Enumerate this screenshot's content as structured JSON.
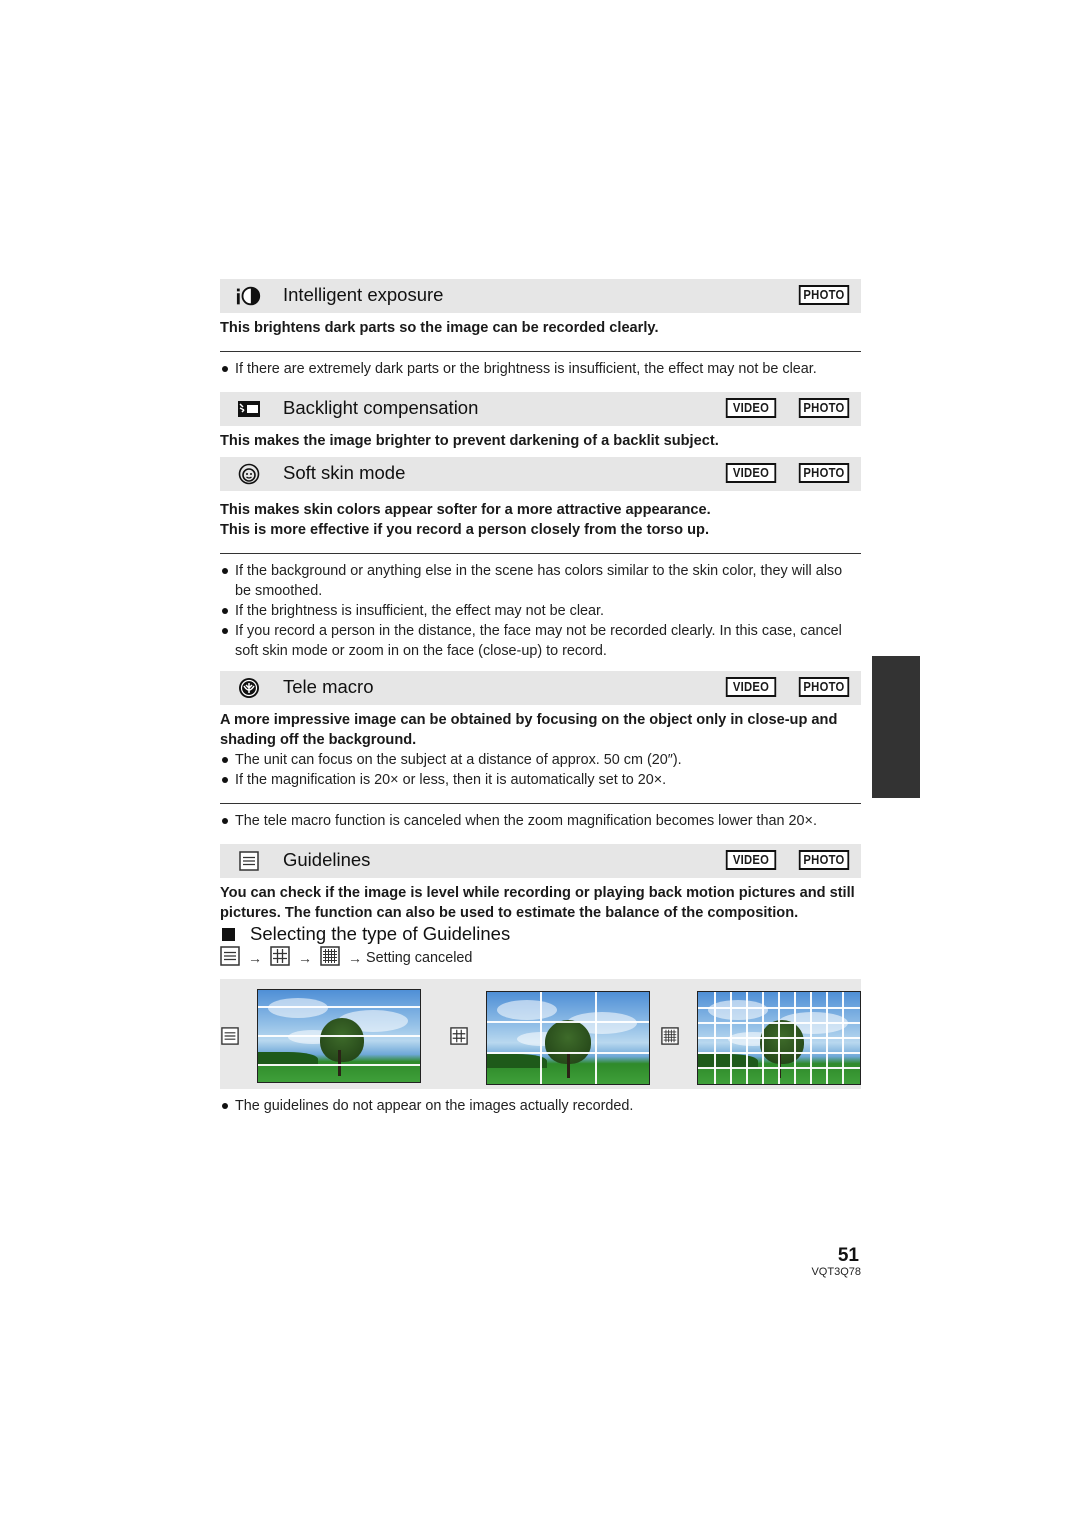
{
  "sections": [
    {
      "id": "intelligent-exposure",
      "icon": "intelligent-exposure-icon",
      "title": "Intelligent exposure",
      "badges": [
        "PHOTO"
      ],
      "lead": [
        "This brightens dark parts so the image can be recorded clearly."
      ],
      "notes": [
        "If there are extremely dark parts or the brightness is insufficient, the effect may not be clear."
      ]
    },
    {
      "id": "backlight-compensation",
      "icon": "backlight-icon",
      "title": "Backlight compensation",
      "badges": [
        "VIDEO",
        "PHOTO"
      ],
      "lead": [
        "This makes the image brighter to prevent darkening of a backlit subject."
      ]
    },
    {
      "id": "soft-skin-mode",
      "icon": "soft-skin-icon",
      "title": "Soft skin mode",
      "badges": [
        "VIDEO",
        "PHOTO"
      ],
      "lead": [
        "This makes skin colors appear softer for a more attractive appearance.",
        "This is more effective if you record a person closely from the torso up."
      ],
      "notes": [
        "If the background or anything else in the scene has colors similar to the skin color, they will also be smoothed.",
        "If the brightness is insufficient, the effect may not be clear.",
        "If you record a person in the distance, the face may not be recorded clearly. In this case, cancel soft skin mode or zoom in on the face (close-up) to record."
      ]
    },
    {
      "id": "tele-macro",
      "icon": "tele-macro-icon",
      "title": "Tele macro",
      "badges": [
        "VIDEO",
        "PHOTO"
      ],
      "lead": [
        "A more impressive image can be obtained by focusing on the object only in close-up and shading off the background."
      ],
      "bullets": [
        "The unit can focus on the subject at a distance of approx. 50 cm (20″).",
        "If the magnification is 20× or less, then it is automatically set to 20×."
      ],
      "notes": [
        "The tele macro function is canceled when the zoom magnification becomes lower than 20×."
      ]
    },
    {
      "id": "guidelines",
      "icon": "guidelines-icon",
      "title": "Guidelines",
      "badges": [
        "VIDEO",
        "PHOTO"
      ],
      "lead": [
        "You can check if the image is level while recording or playing back motion pictures and still pictures. The function can also be used to estimate the balance of the composition."
      ]
    }
  ],
  "guidelines_sub": {
    "heading": "Selecting the type of Guidelines",
    "sequence_arrow": "→",
    "sequence_end": "Setting canceled",
    "types": [
      "horizontal-lines",
      "3x3-grid",
      "fine-grid"
    ],
    "note": "The guidelines do not appear on the images actually recorded."
  },
  "footer": {
    "page_number": "51",
    "doc_code": "VQT3Q78"
  }
}
